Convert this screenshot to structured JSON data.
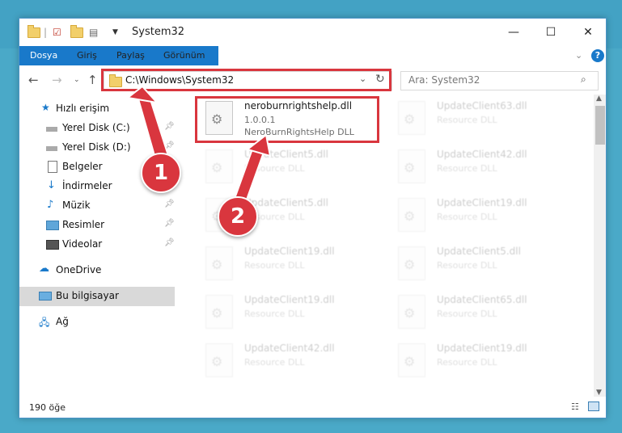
{
  "window": {
    "title": "System32",
    "controls": {
      "minimize": "—",
      "maximize": "☐",
      "close": "✕"
    }
  },
  "ribbon": {
    "tabs": [
      "Dosya",
      "Giriş",
      "Paylaş",
      "Görünüm"
    ],
    "help": "?"
  },
  "address": {
    "path": "C:\\Windows\\System32",
    "search_placeholder": "Ara: System32"
  },
  "sidebar": {
    "items": [
      {
        "label": "Hızlı erişim",
        "icon": "star-icon"
      },
      {
        "label": "Yerel Disk (C:)",
        "icon": "drive-icon",
        "pinned": true
      },
      {
        "label": "Yerel Disk (D:)",
        "icon": "drive-icon",
        "pinned": true
      },
      {
        "label": "Belgeler",
        "icon": "document-icon",
        "pinned": true
      },
      {
        "label": "İndirmeler",
        "icon": "download-icon",
        "pinned": true
      },
      {
        "label": "Müzik",
        "icon": "music-icon",
        "pinned": true
      },
      {
        "label": "Resimler",
        "icon": "pictures-icon",
        "pinned": true
      },
      {
        "label": "Videolar",
        "icon": "video-icon",
        "pinned": true
      },
      {
        "label": "OneDrive",
        "icon": "cloud-icon"
      },
      {
        "label": "Bu bilgisayar",
        "icon": "computer-icon"
      },
      {
        "label": "Ağ",
        "icon": "network-icon"
      }
    ]
  },
  "files": [
    {
      "name": "neroburnrightshelp.dll",
      "version": "1.0.0.1",
      "description": "NeroBurnRightsHelp DLL"
    },
    {
      "name": "UpdateClient63.dll",
      "description": "Resource DLL"
    },
    {
      "name": "UpdateClient5.dll",
      "description": "Resource DLL"
    },
    {
      "name": "UpdateClient42.dll",
      "description": "Resource DLL"
    },
    {
      "name": "UpdateClient5.dll",
      "description": "Resource DLL"
    },
    {
      "name": "UpdateClient19.dll",
      "description": "Resource DLL"
    },
    {
      "name": "UpdateClient19.dll",
      "description": "Resource DLL"
    },
    {
      "name": "UpdateClient5.dll",
      "description": "Resource DLL"
    },
    {
      "name": "UpdateClient19.dll",
      "description": "Resource DLL"
    },
    {
      "name": "UpdateClient65.dll",
      "description": "Resource DLL"
    },
    {
      "name": "UpdateClient42.dll",
      "description": "Resource DLL"
    },
    {
      "name": "UpdateClient19.dll",
      "description": "Resource DLL"
    }
  ],
  "status": {
    "item_count": "190 öğe"
  },
  "callouts": [
    "1",
    "2"
  ],
  "colors": {
    "accent": "#1979ca",
    "highlight": "#d9363e"
  }
}
